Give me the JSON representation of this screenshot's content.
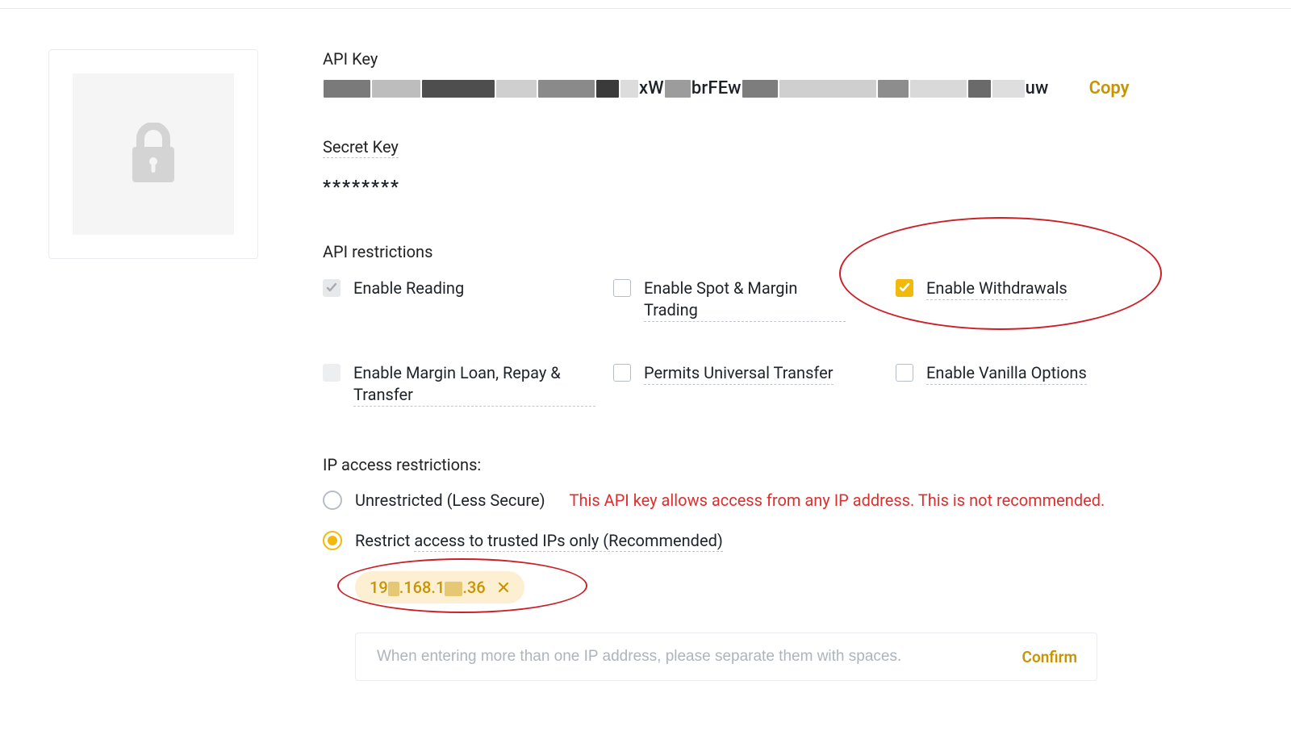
{
  "api": {
    "key_label": "API Key",
    "key_copy": "Copy",
    "key_value_fragments": [
      "xW",
      "brFEw",
      "uw"
    ],
    "secret_label": "Secret Key",
    "secret_value": "********"
  },
  "restrictions": {
    "heading": "API restrictions",
    "options": {
      "reading": "Enable Reading",
      "spot_margin": "Enable Spot & Margin Trading",
      "withdrawals": "Enable Withdrawals",
      "margin_loan": "Enable Margin Loan, Repay & Transfer",
      "universal_transfer": "Permits Universal Transfer",
      "vanilla": "Enable Vanilla Options"
    },
    "checked": {
      "reading": true,
      "withdrawals": true
    }
  },
  "ip": {
    "heading": "IP access restrictions:",
    "unrestricted_label": "Unrestricted (Less Secure)",
    "unrestricted_warning": "This API key allows access from any IP address. This is not recommended.",
    "restrict_label": "Restrict access to trusted IPs only (Recommended)",
    "selected": "restrict",
    "chip_parts": [
      "19",
      ".168.1",
      ".36"
    ],
    "input_placeholder": "When entering more than one IP address, please separate them with spaces.",
    "confirm_label": "Confirm"
  },
  "icons": {
    "lock": "lock-icon",
    "check": "check-icon",
    "close": "close-icon"
  }
}
